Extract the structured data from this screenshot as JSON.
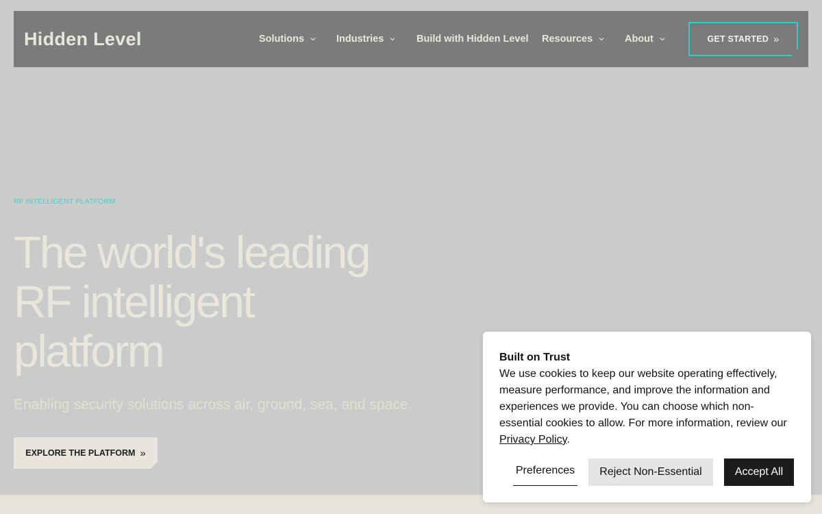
{
  "nav": {
    "logo": "Hidden Level",
    "items": [
      {
        "label": "Solutions",
        "has_dropdown": true
      },
      {
        "label": "Industries",
        "has_dropdown": true
      },
      {
        "label": "Build with Hidden Level",
        "has_dropdown": false
      },
      {
        "label": "Resources",
        "has_dropdown": true
      },
      {
        "label": "About",
        "has_dropdown": true
      }
    ],
    "cta_label": "GET STARTED",
    "cta_icon": "double-chevron-right-icon"
  },
  "hero": {
    "eyebrow": "RF INTELLIGENT PLATFORM",
    "headline_lines": [
      "The world's leading",
      "RF intelligent",
      "platform"
    ],
    "subheadline": "Enabling security solutions across air, ground, sea, and space.",
    "explore_label": "EXPLORE THE PLATFORM"
  },
  "cookie": {
    "title": "Built on Trust",
    "body": "We use cookies to keep our website operating effectively, measure performance, and improve the information and experiences we provide. You can choose which non-essential cookies to allow. For more information, review our ",
    "link": "Privacy Policy",
    "after_link": ".",
    "preferences_label": "Preferences",
    "reject_label": "Reject Non-Essential",
    "accept_label": "Accept All"
  },
  "colors": {
    "accent_teal": "#39c9c2",
    "nav_bg": "#7b7b7b",
    "hero_bg": "#cbcbcb",
    "cream": "#e8e5dc"
  }
}
